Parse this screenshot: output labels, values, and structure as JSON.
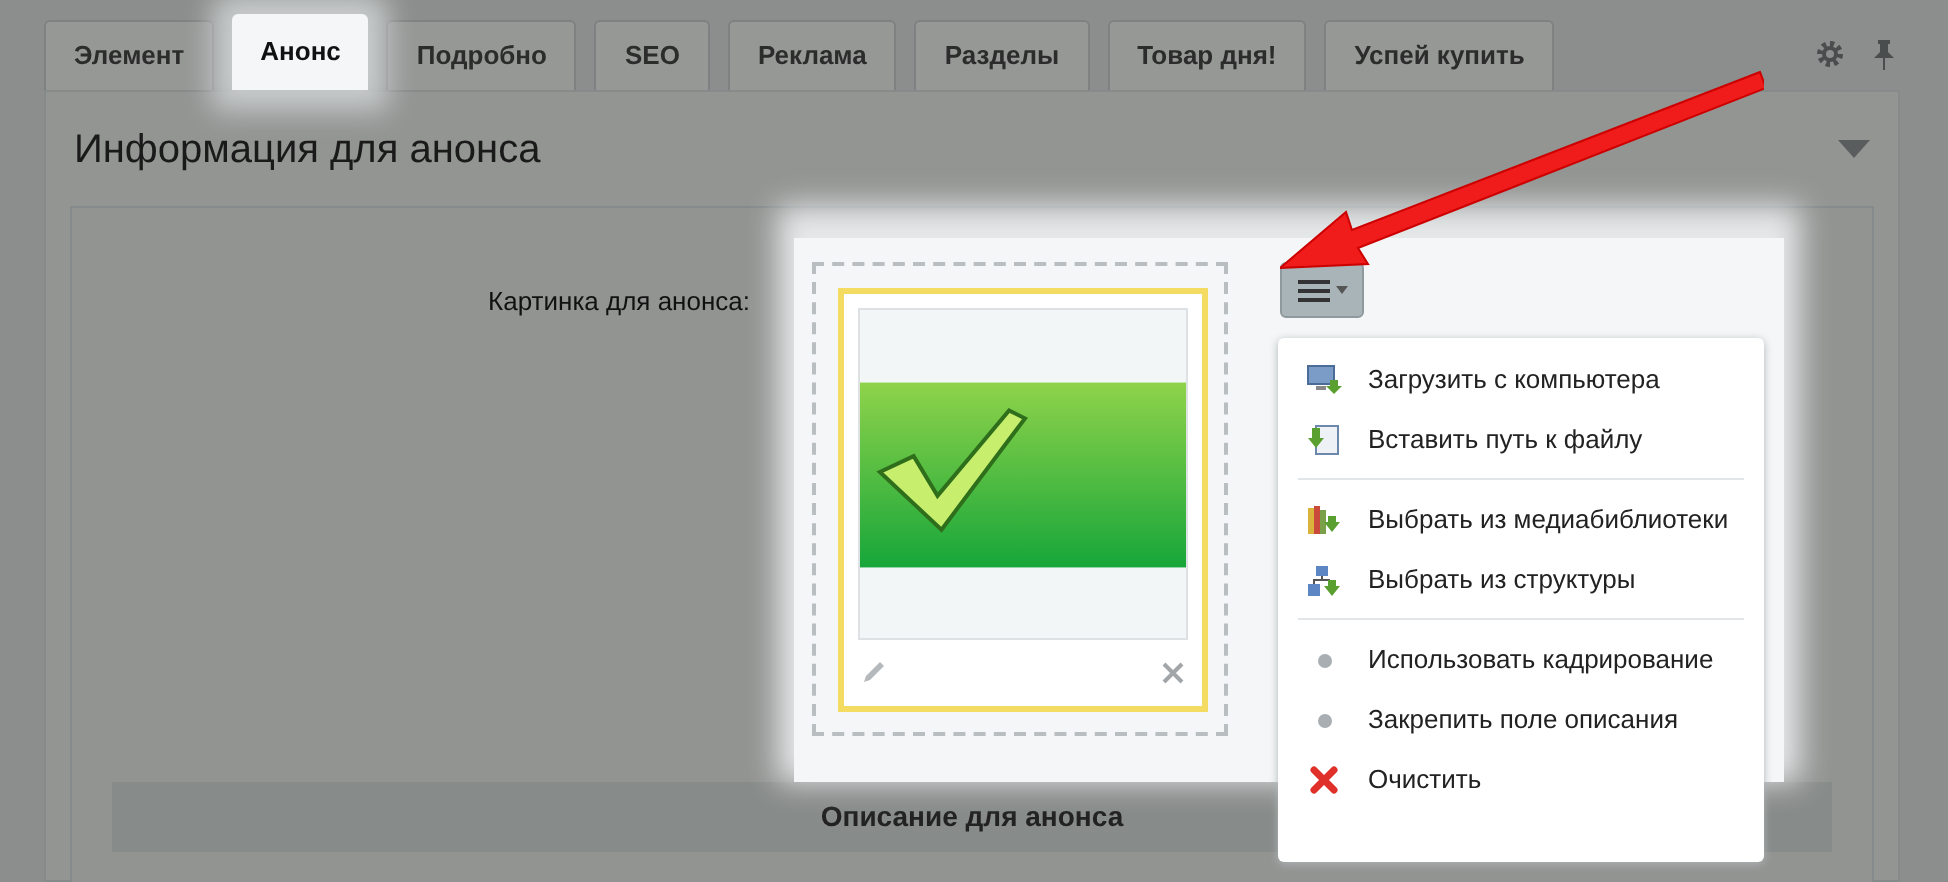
{
  "tabs": [
    {
      "label": "Элемент",
      "selected": false
    },
    {
      "label": "Анонс",
      "selected": true
    },
    {
      "label": "Подробно",
      "selected": false
    },
    {
      "label": "SEO",
      "selected": false
    },
    {
      "label": "Реклама",
      "selected": false
    },
    {
      "label": "Разделы",
      "selected": false
    },
    {
      "label": "Товар дня!",
      "selected": false
    },
    {
      "label": "Успей купить",
      "selected": false
    }
  ],
  "section": {
    "title": "Информация для анонса"
  },
  "field": {
    "label": "Картинка для анонса:"
  },
  "image_menu": {
    "groups": [
      [
        {
          "kind": "upload",
          "label": "Загрузить с компьютера"
        },
        {
          "kind": "path",
          "label": "Вставить путь к файлу"
        }
      ],
      [
        {
          "kind": "medialib",
          "label": "Выбрать из медиабиблиотеки"
        },
        {
          "kind": "structure",
          "label": "Выбрать из структуры"
        }
      ],
      [
        {
          "kind": "option",
          "label": "Использовать кадрирование"
        },
        {
          "kind": "option",
          "label": "Закрепить поле описания"
        },
        {
          "kind": "clear",
          "label": "Очистить"
        }
      ]
    ]
  },
  "description_bar": {
    "title": "Описание для анонса"
  }
}
